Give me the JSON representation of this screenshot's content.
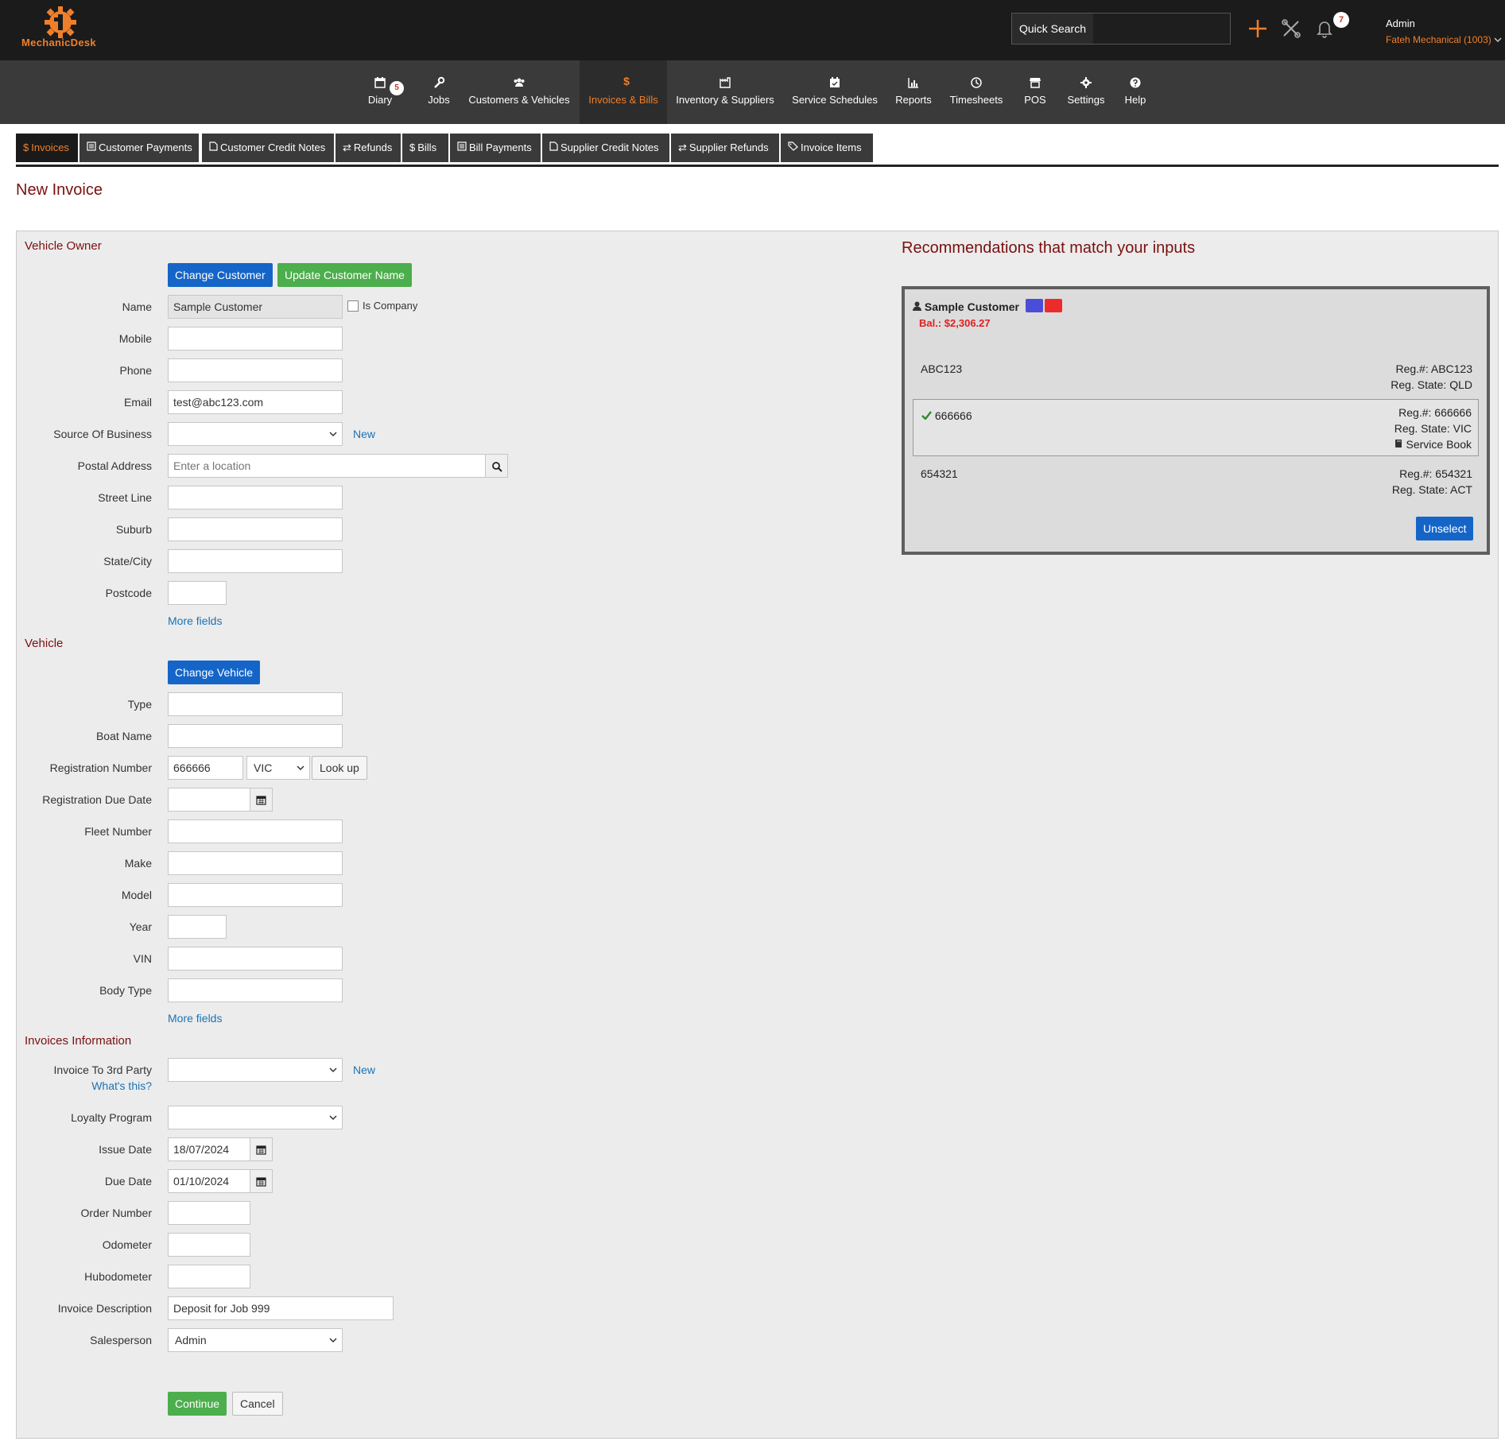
{
  "app": {
    "logo_text": "MechanicDesk"
  },
  "topbar": {
    "quick_search_label": "Quick Search",
    "quick_search_value": "",
    "notification_count": "7",
    "user_name": "Admin",
    "user_company": "Fateh Mechanical (1003)"
  },
  "nav": {
    "diary": "Diary",
    "diary_badge": "5",
    "jobs": "Jobs",
    "customers": "Customers & Vehicles",
    "invoices": "Invoices & Bills",
    "invoices_icon": "$",
    "inventory": "Inventory & Suppliers",
    "service": "Service Schedules",
    "reports": "Reports",
    "timesheets": "Timesheets",
    "pos": "POS",
    "settings": "Settings",
    "help": "Help"
  },
  "subtabs": {
    "invoices": "Invoices",
    "customer_payments": "Customer Payments",
    "customer_credit_notes": "Customer Credit Notes",
    "refunds": "Refunds",
    "bills": "Bills",
    "bill_payments": "Bill Payments",
    "supplier_credit_notes": "Supplier Credit Notes",
    "supplier_refunds": "Supplier Refunds",
    "invoice_items": "Invoice Items",
    "dollar": "$"
  },
  "page": {
    "title": "New Invoice"
  },
  "owner": {
    "section": "Vehicle Owner",
    "change_customer": "Change Customer",
    "update_customer_name": "Update Customer Name",
    "name_label": "Name",
    "name_value": "Sample Customer",
    "is_company": "Is Company",
    "mobile_label": "Mobile",
    "mobile_value": "",
    "phone_label": "Phone",
    "phone_value": "",
    "email_label": "Email",
    "email_value": "test@abc123.com",
    "source_label": "Source Of Business",
    "source_value": "",
    "new_link": "New",
    "postal_label": "Postal Address",
    "postal_placeholder": "Enter a location",
    "street_label": "Street Line",
    "street_value": "",
    "suburb_label": "Suburb",
    "suburb_value": "",
    "state_label": "State/City",
    "state_value": "",
    "postcode_label": "Postcode",
    "postcode_value": "",
    "more_fields": "More fields"
  },
  "vehicle": {
    "section": "Vehicle",
    "change_vehicle": "Change Vehicle",
    "type_label": "Type",
    "type_value": "",
    "boat_label": "Boat Name",
    "boat_value": "",
    "reg_label": "Registration Number",
    "reg_value": "666666",
    "reg_state": "VIC",
    "lookup": "Look up",
    "reg_due_label": "Registration Due Date",
    "reg_due_value": "",
    "fleet_label": "Fleet Number",
    "fleet_value": "",
    "make_label": "Make",
    "make_value": "",
    "model_label": "Model",
    "model_value": "",
    "year_label": "Year",
    "year_value": "",
    "vin_label": "VIN",
    "vin_value": "",
    "body_label": "Body Type",
    "body_value": "",
    "more_fields": "More fields"
  },
  "invoice": {
    "section": "Invoices Information",
    "third_party_label": "Invoice To 3rd Party",
    "whats_this": "What's this?",
    "third_party_value": "",
    "new_link": "New",
    "loyalty_label": "Loyalty Program",
    "loyalty_value": "",
    "issue_label": "Issue Date",
    "issue_value": "18/07/2024",
    "due_label": "Due Date",
    "due_value": "01/10/2024",
    "order_label": "Order Number",
    "order_value": "",
    "odometer_label": "Odometer",
    "odometer_value": "",
    "hubodometer_label": "Hubodometer",
    "hubodometer_value": "",
    "desc_label": "Invoice Description",
    "desc_value": "Deposit for Job 999",
    "sales_label": "Salesperson",
    "sales_value": "Admin",
    "continue": "Continue",
    "cancel": "Cancel"
  },
  "recommendations": {
    "title": "Recommendations that match your inputs",
    "customer": "Sample Customer",
    "balance": "Bal.: $2,306.27",
    "chip_colors": [
      "#4a4ed6",
      "#ee2b2b"
    ],
    "vehicles": [
      {
        "name": "ABC123",
        "reg": "Reg.#: ABC123",
        "state": "Reg. State: QLD",
        "extra": ""
      },
      {
        "name": "666666",
        "reg": "Reg.#: 666666",
        "state": "Reg. State: VIC",
        "extra": "Service Book"
      },
      {
        "name": "654321",
        "reg": "Reg.#: 654321",
        "state": "Reg. State: ACT",
        "extra": ""
      }
    ],
    "unselect": "Unselect"
  },
  "colors": {
    "accent": "#f07f2b",
    "heading": "#7a1010",
    "primary_button": "#1565c8",
    "success_button": "#4cae4c",
    "link": "#1a73b5"
  }
}
